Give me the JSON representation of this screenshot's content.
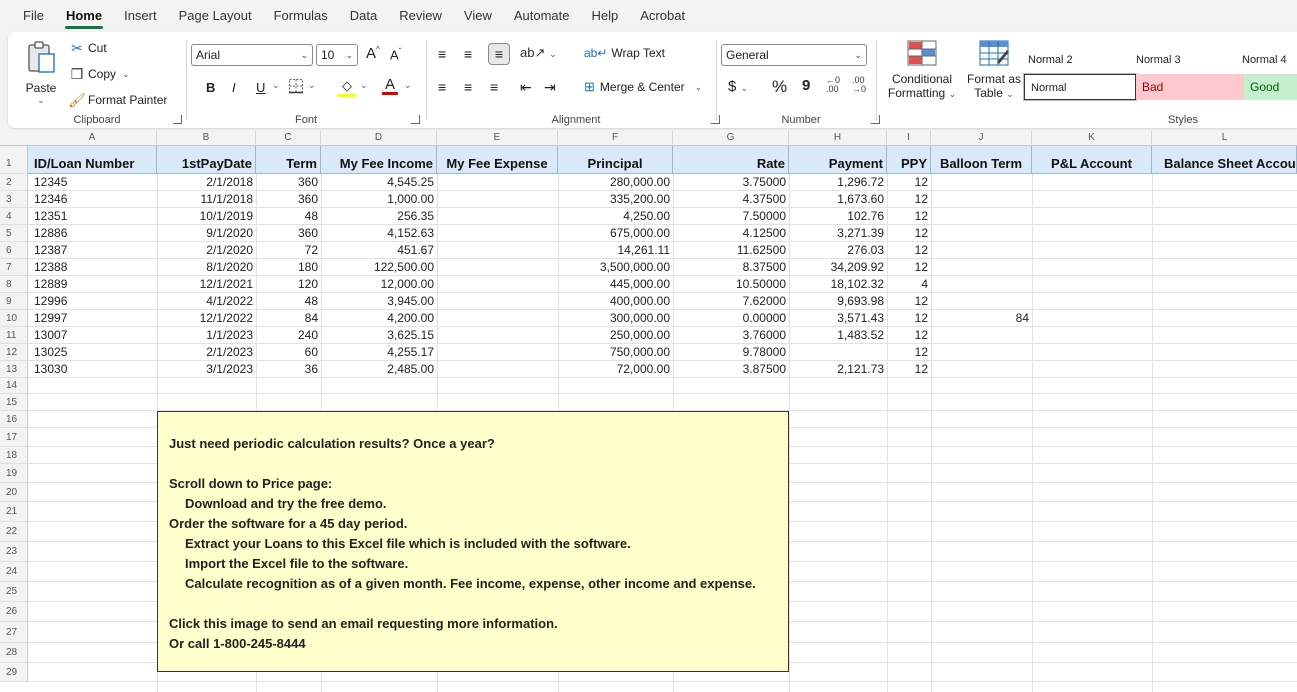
{
  "menu": {
    "tabs": [
      "File",
      "Home",
      "Insert",
      "Page Layout",
      "Formulas",
      "Data",
      "Review",
      "View",
      "Automate",
      "Help",
      "Acrobat"
    ],
    "active": "Home"
  },
  "ribbon": {
    "clipboard": {
      "label": "Clipboard",
      "paste": "Paste",
      "cut": "Cut",
      "copy": "Copy",
      "format_painter": "Format Painter"
    },
    "font": {
      "label": "Font",
      "font_name": "Arial",
      "font_size": "10",
      "bold": "B",
      "italic": "I",
      "underline": "U",
      "grow": "A",
      "shrink": "A",
      "font_color_glyph": "A"
    },
    "alignment": {
      "label": "Alignment",
      "wrap_text": "Wrap Text",
      "merge_center": "Merge & Center"
    },
    "number": {
      "label": "Number",
      "format": "General",
      "currency": "$",
      "percent": "%",
      "comma": "9",
      "inc_decimal": ".00",
      "dec_decimal": ".00"
    },
    "styles": {
      "label": "Styles",
      "conditional_formatting_1": "Conditional",
      "conditional_formatting_2": "Formatting",
      "format_table_1": "Format as",
      "format_table_2": "Table",
      "normal2": "Normal 2",
      "normal3": "Normal 3",
      "normal4": "Normal 4",
      "normal": "Normal",
      "bad": "Bad",
      "good": "Good"
    },
    "colors": {
      "accent": "#107c41",
      "bad_bg": "#ffc7ce",
      "bad_fg": "#9c0006",
      "good_bg": "#c6efce",
      "good_fg": "#006100"
    }
  },
  "columns": [
    "A",
    "B",
    "C",
    "D",
    "E",
    "F",
    "G",
    "H",
    "I",
    "J",
    "K",
    "L"
  ],
  "rows": [
    "1",
    "2",
    "3",
    "4",
    "5",
    "6",
    "7",
    "8",
    "9",
    "10",
    "11",
    "12",
    "13",
    "14",
    "15",
    "16",
    "17",
    "18",
    "19",
    "20",
    "21",
    "22",
    "23",
    "24",
    "25",
    "26",
    "27",
    "28",
    "29"
  ],
  "headers": [
    "ID/Loan Number",
    "1stPayDate",
    "Term",
    "My Fee Income",
    "My Fee Expense",
    "Principal",
    "Rate",
    "Payment",
    "PPY",
    "Balloon Term",
    "P&L Account",
    "Balance Sheet Account"
  ],
  "data": [
    [
      "12345",
      "2/1/2018",
      "360",
      "4,545.25",
      "",
      "280,000.00",
      "3.75000",
      "1,296.72",
      "12",
      ""
    ],
    [
      "12346",
      "11/1/2018",
      "360",
      "1,000.00",
      "",
      "335,200.00",
      "4.37500",
      "1,673.60",
      "12",
      ""
    ],
    [
      "12351",
      "10/1/2019",
      "48",
      "256.35",
      "",
      "4,250.00",
      "7.50000",
      "102.76",
      "12",
      ""
    ],
    [
      "12886",
      "9/1/2020",
      "360",
      "4,152.63",
      "",
      "675,000.00",
      "4.12500",
      "3,271.39",
      "12",
      ""
    ],
    [
      "12387",
      "2/1/2020",
      "72",
      "451.67",
      "",
      "14,261.11",
      "11.62500",
      "276.03",
      "12",
      ""
    ],
    [
      "12388",
      "8/1/2020",
      "180",
      "122,500.00",
      "",
      "3,500,000.00",
      "8.37500",
      "34,209.92",
      "12",
      ""
    ],
    [
      "12889",
      "12/1/2021",
      "120",
      "12,000.00",
      "",
      "445,000.00",
      "10.50000",
      "18,102.32",
      "4",
      ""
    ],
    [
      "12996",
      "4/1/2022",
      "48",
      "3,945.00",
      "",
      "400,000.00",
      "7.62000",
      "9,693.98",
      "12",
      ""
    ],
    [
      "12997",
      "12/1/2022",
      "84",
      "4,200.00",
      "",
      "300,000.00",
      "0.00000",
      "3,571.43",
      "12",
      "84"
    ],
    [
      "13007",
      "1/1/2023",
      "240",
      "3,625.15",
      "",
      "250,000.00",
      "3.76000",
      "1,483.52",
      "12",
      ""
    ],
    [
      "13025",
      "2/1/2023",
      "60",
      "4,255.17",
      "",
      "750,000.00",
      "9.78000",
      "",
      "12",
      ""
    ],
    [
      "13030",
      "3/1/2023",
      "36",
      "2,485.00",
      "",
      "72,000.00",
      "3.87500",
      "2,121.73",
      "12",
      ""
    ]
  ],
  "promo": {
    "title": "Just need periodic calculation results?  Once a year?",
    "l1": "Scroll down to Price page:",
    "l2": "Download and try the free demo.",
    "l3": "Order the software for a 45 day period.",
    "l4": "Extract your Loans to this Excel file which is included with the software.",
    "l5": "Import the Excel file to the software.",
    "l6": "Calculate recognition as of a given month.  Fee income, expense, other income and expense.",
    "l7": "Click this image to send an email requesting more information.",
    "l8": "Or call 1-800-245-8444"
  }
}
